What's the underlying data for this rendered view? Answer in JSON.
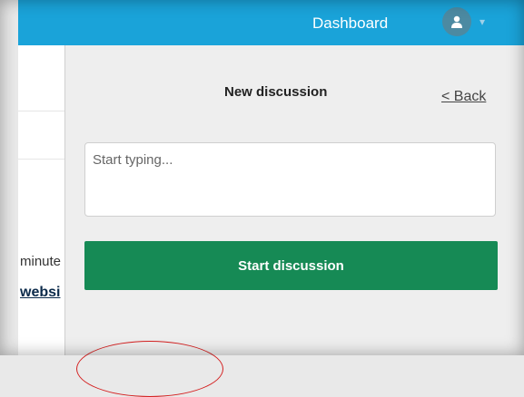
{
  "header": {
    "dashboard_label": "Dashboard",
    "avatar_icon": "user-icon",
    "menu_icon": "chevron-down-icon"
  },
  "left_pane": {
    "text_line_1": "minute",
    "link_text": "websi"
  },
  "discussion_panel": {
    "title": "New discussion",
    "back_link": "< Back",
    "input_placeholder": "Start typing...",
    "input_value": "",
    "submit_label": "Start discussion"
  },
  "colors": {
    "header_bg": "#1aa3d9",
    "button_green": "#168a55",
    "annotation_red": "#d42020"
  }
}
